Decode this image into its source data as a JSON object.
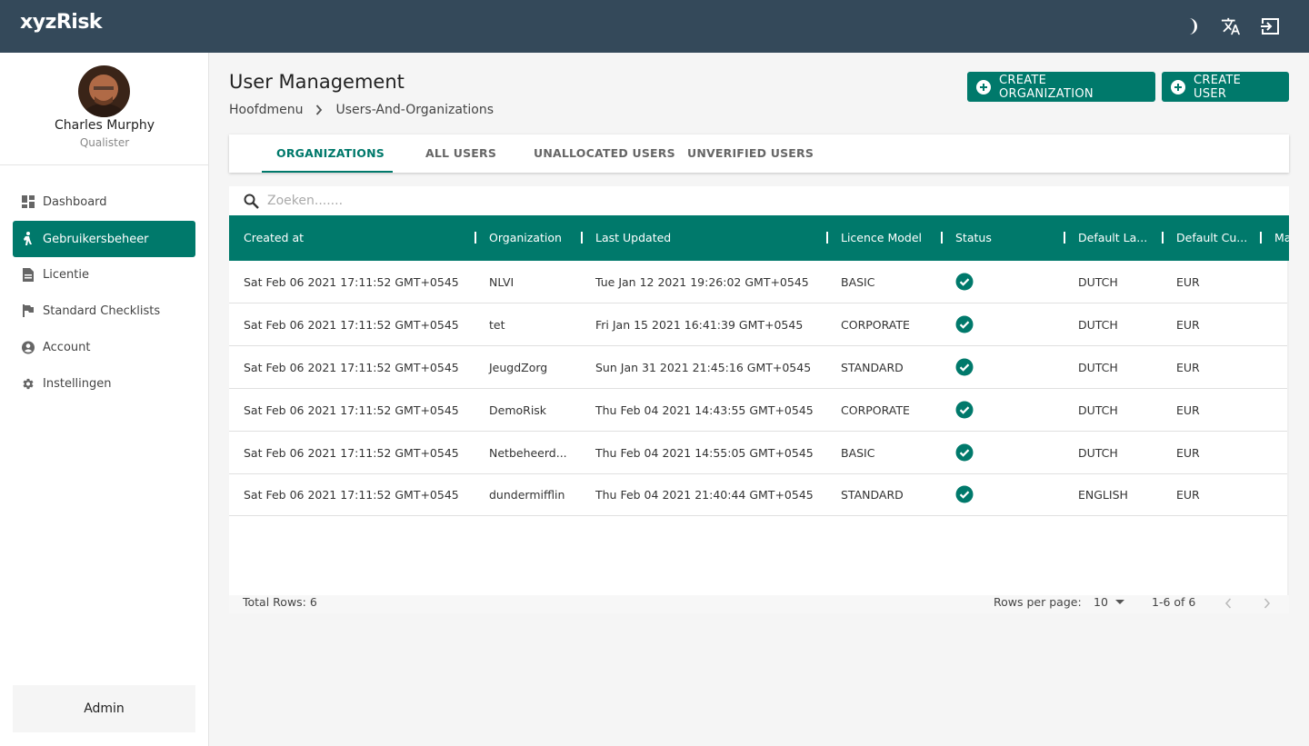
{
  "app": {
    "logo": "xyzRisk"
  },
  "topbar": {
    "icons": [
      "dark-mode-icon",
      "translate-icon",
      "logout-icon"
    ]
  },
  "user": {
    "name": "Charles Murphy",
    "role": "Qualister"
  },
  "sidebar": {
    "items": [
      {
        "label": "Dashboard",
        "icon": "dashboard-icon"
      },
      {
        "label": "Gebruikersbeheer",
        "icon": "person-icon",
        "active": true
      },
      {
        "label": "Licentie",
        "icon": "document-icon"
      },
      {
        "label": "Standard Checklists",
        "icon": "flag-icon"
      },
      {
        "label": "Account",
        "icon": "account-circle-icon"
      },
      {
        "label": "Instellingen",
        "icon": "gear-icon"
      }
    ],
    "footer_label": "Admin"
  },
  "page": {
    "title": "User Management",
    "breadcrumb": [
      "Hoofdmenu",
      "Users-And-Organizations"
    ],
    "buttons": {
      "create_org": "CREATE ORGANIZATION",
      "create_user": "CREATE USER"
    }
  },
  "tabs": [
    "ORGANIZATIONS",
    "ALL USERS",
    "UNALLOCATED USERS",
    "UNVERIFIED USERS"
  ],
  "search": {
    "placeholder": "Zoeken......."
  },
  "table": {
    "columns": [
      "Created at",
      "Organization",
      "Last Updated",
      "Licence Model",
      "Status",
      "Default La...",
      "Default Cu...",
      "Ma"
    ],
    "rows": [
      [
        "Sat Feb 06 2021 17:11:52 GMT+0545",
        "NLVI",
        "Tue Jan 12 2021 19:26:02 GMT+0545",
        "BASIC",
        "check-circle-icon",
        "DUTCH",
        "EUR"
      ],
      [
        "Sat Feb 06 2021 17:11:52 GMT+0545",
        "tet",
        "Fri Jan 15 2021 16:41:39 GMT+0545",
        "CORPORATE",
        "check-circle-icon",
        "DUTCH",
        "EUR"
      ],
      [
        "Sat Feb 06 2021 17:11:52 GMT+0545",
        "JeugdZorg",
        "Sun Jan 31 2021 21:45:16 GMT+0545",
        "STANDARD",
        "check-circle-icon",
        "DUTCH",
        "EUR"
      ],
      [
        "Sat Feb 06 2021 17:11:52 GMT+0545",
        "DemoRisk",
        "Thu Feb 04 2021 14:43:55 GMT+0545",
        "CORPORATE",
        "check-circle-icon",
        "DUTCH",
        "EUR"
      ],
      [
        "Sat Feb 06 2021 17:11:52 GMT+0545",
        "Netbeheerd...",
        "Thu Feb 04 2021 14:55:05 GMT+0545",
        "BASIC",
        "check-circle-icon",
        "DUTCH",
        "EUR"
      ],
      [
        "Sat Feb 06 2021 17:11:52 GMT+0545",
        "dundermifflin",
        "Thu Feb 04 2021 21:40:44 GMT+0545",
        "STANDARD",
        "check-circle-icon",
        "ENGLISH",
        "EUR"
      ]
    ],
    "footer": {
      "total": "Total Rows: 6",
      "rows_per_page_label": "Rows per page:",
      "rows_per_page_value": "10",
      "range": "1-6 of 6"
    }
  },
  "colors": {
    "topbar": "#34495a",
    "accent": "#00796b"
  }
}
